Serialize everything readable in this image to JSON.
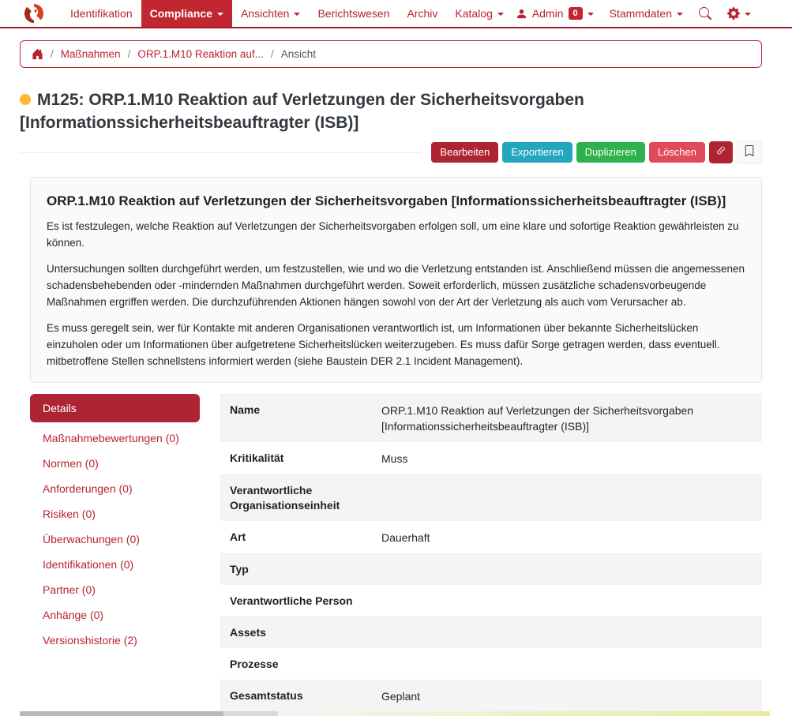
{
  "navbar": {
    "items": [
      {
        "label": "Identifikation",
        "active": false,
        "caret": false
      },
      {
        "label": "Compliance",
        "active": true,
        "caret": true
      },
      {
        "label": "Ansichten",
        "active": false,
        "caret": true
      },
      {
        "label": "Berichtswesen",
        "active": false,
        "caret": false
      },
      {
        "label": "Archiv",
        "active": false,
        "caret": false
      },
      {
        "label": "Katalog",
        "active": false,
        "caret": true
      }
    ],
    "user": {
      "label": "Admin",
      "badge": "0"
    },
    "stammdaten_label": "Stammdaten"
  },
  "breadcrumb": {
    "items": [
      {
        "sep": "/",
        "label": "Maßnahmen",
        "current": false
      },
      {
        "sep": "/",
        "label": "ORP.1.M10 Reaktion auf...",
        "current": false
      },
      {
        "sep": "/",
        "label": "Ansicht",
        "current": true
      }
    ]
  },
  "page": {
    "title": "M125: ORP.1.M10 Reaktion auf Verletzungen der Sicherheitsvorgaben [Informationssicherheitsbeauftragter (ISB)]",
    "status_dot_color": "#fdb92c"
  },
  "toolbar": {
    "buttons": [
      {
        "label": "Bearbeiten",
        "color": "#ae2433"
      },
      {
        "label": "Exportieren",
        "color": "#22a7bf"
      },
      {
        "label": "Duplizieren",
        "color": "#2fb14c"
      },
      {
        "label": "Löschen",
        "color": "#e14b59"
      }
    ]
  },
  "description": {
    "heading": "ORP.1.M10 Reaktion auf Verletzungen der Sicherheitsvorgaben [Informationssicherheitsbeauftragter (ISB)]",
    "paragraphs": [
      "Es ist festzulegen, welche Reaktion auf Verletzungen der Sicherheitsvorgaben erfolgen soll, um eine klare und sofortige Reaktion gewährleisten zu können.",
      "Untersuchungen sollten durchgeführt werden, um festzustellen, wie und wo die Verletzung entstanden ist. Anschließend müssen die angemessenen schadensbehebenden oder -mindernden Maßnahmen durchgeführt werden. Soweit erforderlich, müssen zusätzliche schadensvorbeugende Maßnahmen ergriffen werden. Die durchzuführenden Aktionen hängen sowohl von der Art der Verletzung als auch vom Verursacher ab.",
      "Es muss geregelt sein, wer für Kontakte mit anderen Organisationen verantwortlich ist, um Informationen über bekannte Sicherheitslücken einzuholen oder um Informationen über aufgetretene Sicherheitslücken weiterzugeben. Es muss dafür Sorge getragen werden, dass eventuell. mitbetroffene Stellen schnellstens informiert werden (siehe Baustein DER 2.1 Incident Management)."
    ]
  },
  "tabs": {
    "items": [
      {
        "label": "Details",
        "active": true
      },
      {
        "label": "Maßnahmebewertungen (0)",
        "active": false
      },
      {
        "label": "Normen (0)",
        "active": false
      },
      {
        "label": "Anforderungen (0)",
        "active": false
      },
      {
        "label": "Risiken (0)",
        "active": false
      },
      {
        "label": "Überwachungen (0)",
        "active": false
      },
      {
        "label": "Identifikationen (0)",
        "active": false
      },
      {
        "label": "Partner (0)",
        "active": false
      },
      {
        "label": "Anhänge (0)",
        "active": false
      },
      {
        "label": "Versionshistorie (2)",
        "active": false
      }
    ]
  },
  "details": {
    "rows": [
      {
        "label": "Name",
        "value": "ORP.1.M10 Reaktion auf Verletzungen der Sicherheitsvorgaben [Informationssicherheitsbeauftragter (ISB)]"
      },
      {
        "label": "Kritikalität",
        "value": "Muss"
      },
      {
        "label": "Verantwortliche Organisationseinheit",
        "value": ""
      },
      {
        "label": "Art",
        "value": "Dauerhaft"
      },
      {
        "label": "Typ",
        "value": ""
      },
      {
        "label": "Verantwortliche Person",
        "value": ""
      },
      {
        "label": "Assets",
        "value": ""
      },
      {
        "label": "Prozesse",
        "value": ""
      },
      {
        "label": "Gesamtstatus",
        "value": "Geplant"
      }
    ]
  },
  "colors": {
    "accent_red": "#b8232f",
    "active_nav_bg": "#c22631",
    "navbar_border": "#a01c28",
    "stripe_gray": "#f4f4f4",
    "bottom_strip": {
      "thumb": "#b9b9b9",
      "track": "#d9d9d9",
      "status_gradient": [
        "#f4f4f2",
        "#e9ec9e"
      ]
    }
  }
}
